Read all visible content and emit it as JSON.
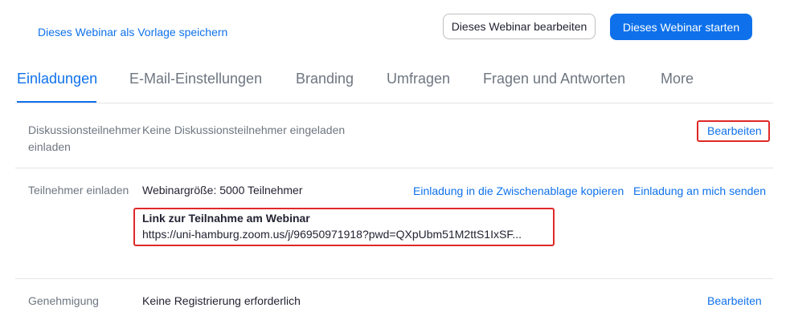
{
  "header": {
    "save_template_link": "Dieses Webinar als Vorlage speichern",
    "edit_button": "Dieses Webinar bearbeiten",
    "start_button": "Dieses Webinar starten"
  },
  "tabs": [
    {
      "label": "Einladungen",
      "active": true
    },
    {
      "label": "E-Mail-Einstellungen",
      "active": false
    },
    {
      "label": "Branding",
      "active": false
    },
    {
      "label": "Umfragen",
      "active": false
    },
    {
      "label": "Fragen und Antworten",
      "active": false
    },
    {
      "label": "More",
      "active": false
    }
  ],
  "panelists": {
    "label_line1": "Diskussionsteilnehmer",
    "label_line2": "einladen",
    "value": "Keine Diskussionsteilnehmer eingeladen",
    "action": "Bearbeiten"
  },
  "attendees": {
    "label": "Teilnehmer einladen",
    "size": "Webinargröße: 5000 Teilnehmer",
    "copy_link": "Einladung in die Zwischenablage kopieren",
    "send_link": "Einladung an mich senden",
    "join_title": "Link zur Teilnahme am Webinar",
    "join_url": "https://uni-hamburg.zoom.us/j/96950971918?pwd=QXpUbm51M2ttS1IxSF..."
  },
  "approval": {
    "label": "Genehmigung",
    "value": "Keine Registrierung erforderlich",
    "action": "Bearbeiten"
  },
  "colors": {
    "accent": "#0e71eb",
    "highlight_box": "#e02828"
  }
}
